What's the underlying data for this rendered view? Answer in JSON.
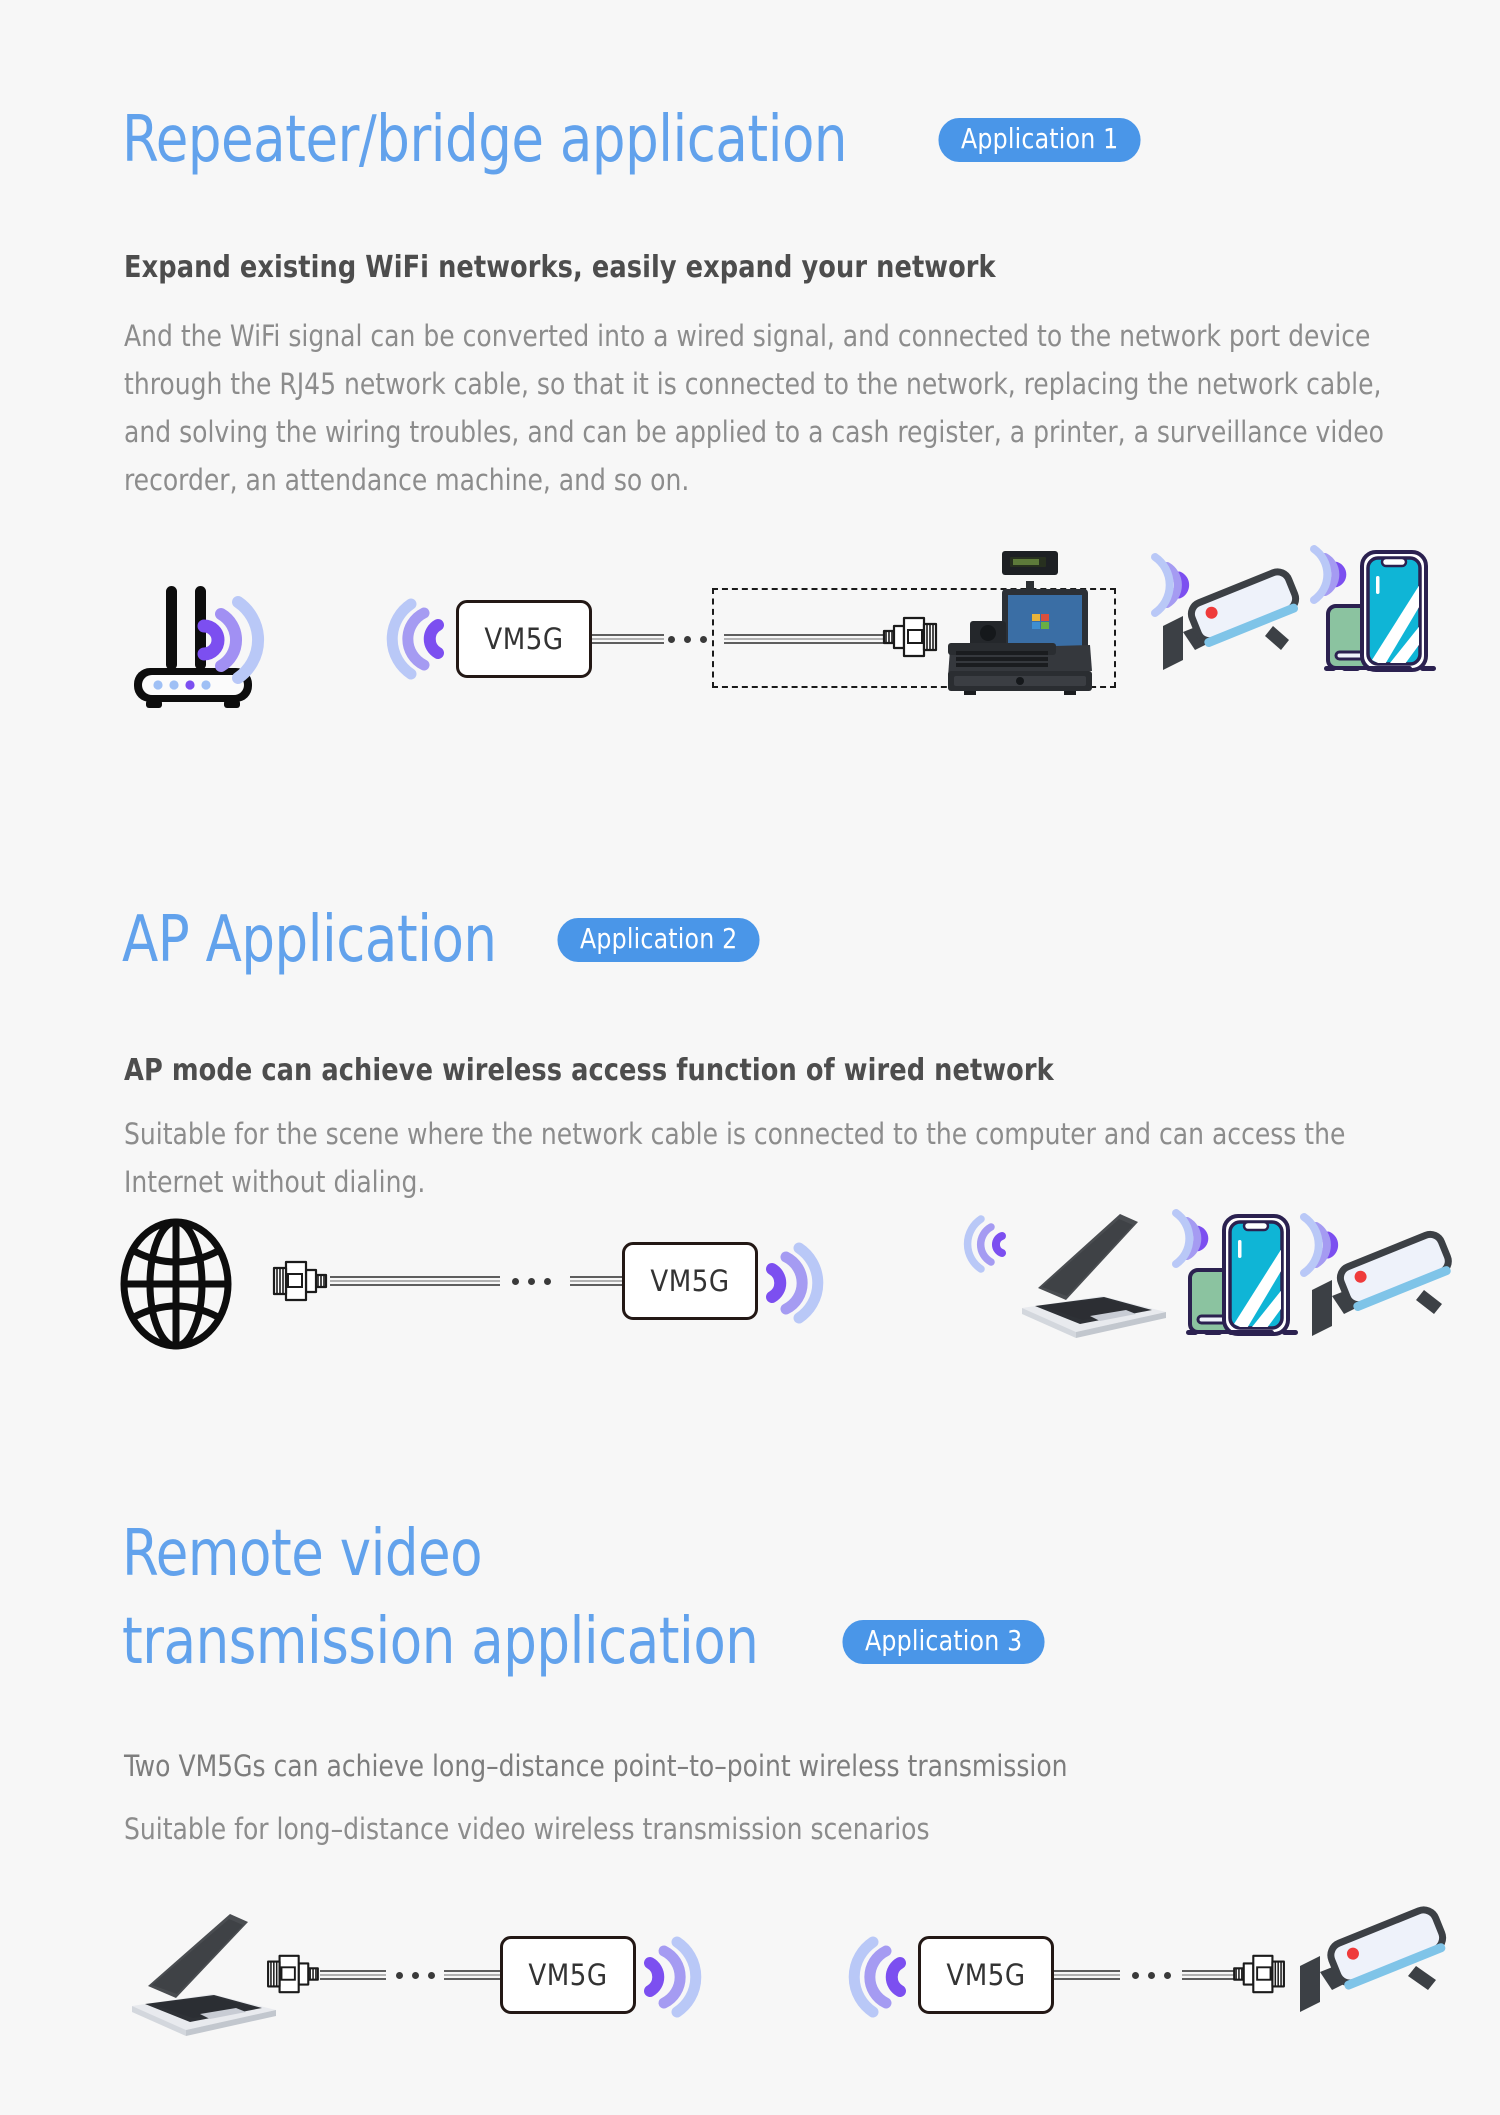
{
  "page": {
    "background": "#f7f7f7",
    "accent_blue": "#62a2ec",
    "badge_blue": "#4a96e8",
    "wave_purple": "#7c4ff0",
    "wave_lightblue": "#b9c8f7"
  },
  "sections": [
    {
      "id": "repeater-bridge",
      "title": "Repeater/bridge application",
      "badge": "Application 1",
      "subtitle": "Expand existing WiFi networks,  easily expand your network",
      "body": "And the WiFi signal can be converted into a wired signal, and connected to the network port device through the RJ45 network cable, so that it is connected to the network, replacing the network cable, and solving the wiring troubles, and can be applied to a cash register, a printer, a surveillance video recorder, an attendance machine, and so on.",
      "device_label": "VM5G",
      "icons": [
        "wifi-router-icon",
        "wifi-waves-icon",
        "vm5g-device-box",
        "ethernet-cable",
        "rj45-connector-icon",
        "cash-register-icon",
        "security-camera-icon",
        "smartphone-icon"
      ]
    },
    {
      "id": "ap-application",
      "title": "AP Application",
      "badge": "Application 2",
      "subtitle": "AP mode can achieve wireless access function of wired network",
      "body": "Suitable for the scene where the network cable is connected to the computer and can access the Internet without dialing.",
      "device_label": "VM5G",
      "icons": [
        "globe-internet-icon",
        "rj45-connector-icon",
        "ethernet-cable",
        "vm5g-device-box",
        "wifi-waves-icon",
        "laptop-icon",
        "smartphone-icon",
        "security-camera-icon"
      ]
    },
    {
      "id": "remote-video-transmission",
      "title_line1": "Remote video",
      "title_line2": "transmission application",
      "badge": "Application 3",
      "subtitle": "Two VM5Gs can achieve long–distance point–to–point wireless transmission",
      "body": "Suitable for long–distance video wireless transmission scenarios",
      "device_label_left": "VM5G",
      "device_label_right": "VM5G",
      "icons": [
        "laptop-icon",
        "rj45-connector-icon",
        "ethernet-cable",
        "vm5g-device-box",
        "wifi-waves-icon",
        "security-camera-icon"
      ]
    }
  ]
}
